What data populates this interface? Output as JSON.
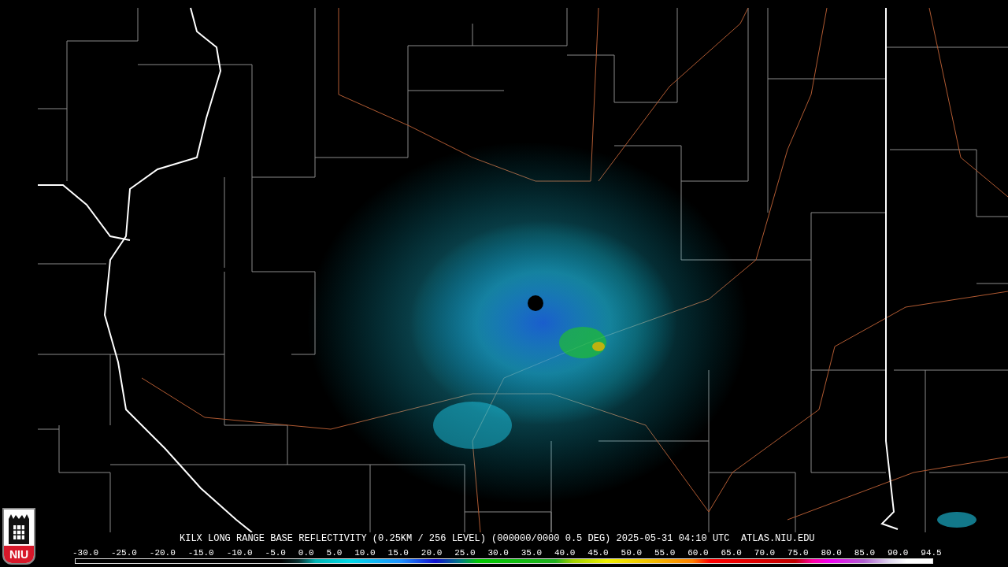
{
  "logo": {
    "text": "NIU"
  },
  "product_title": "KILX LONG RANGE BASE REFLECTIVITY (0.25KM / 256 LEVEL) (000000/0000 0.5 DEG) 2025-05-31 04:10 UTC  ATLAS.NIU.EDU",
  "legend": {
    "ticks": [
      "-30.0",
      "-25.0",
      "-20.0",
      "-15.0",
      "-10.0",
      "-5.0",
      "0.0",
      "5.0",
      "10.0",
      "15.0",
      "20.0",
      "25.0",
      "30.0",
      "35.0",
      "40.0",
      "45.0",
      "50.0",
      "55.0",
      "60.0",
      "65.0",
      "70.0",
      "75.0",
      "80.0",
      "85.0",
      "90.0",
      "94.5"
    ]
  }
}
